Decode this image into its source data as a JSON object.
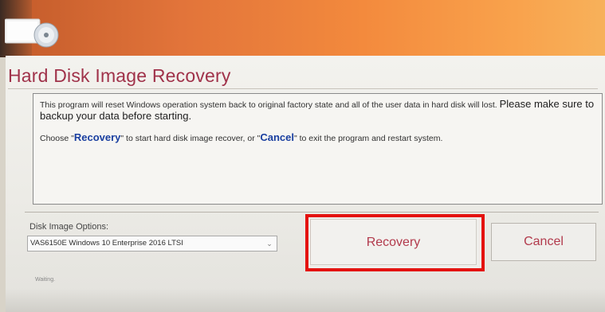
{
  "window": {
    "title": "Hard Disk Image Recovery"
  },
  "description": {
    "line1": "This program will reset Windows operation system back to original factory state and all of the user data in hard disk will lost. ",
    "line1_emphasis": "Please make sure to backup your data before starting.",
    "choose_prefix": "Choose \"",
    "recovery_keyword": "Recovery",
    "choose_middle": "\" to start hard disk image recover, or \"",
    "cancel_keyword": "Cancel",
    "choose_suffix": "\" to exit the program and restart system."
  },
  "options": {
    "label": "Disk Image Options:",
    "selected": "VAS6150E Windows 10 Enterprise 2016 LTSI"
  },
  "buttons": {
    "recovery_label": "Recovery",
    "cancel_label": "Cancel"
  },
  "status": {
    "text": "Waiting."
  },
  "colors": {
    "title": "#a0324a",
    "keyword": "#1a3fa0",
    "highlight_border": "#e4120f",
    "banner": "#f38a3d"
  }
}
